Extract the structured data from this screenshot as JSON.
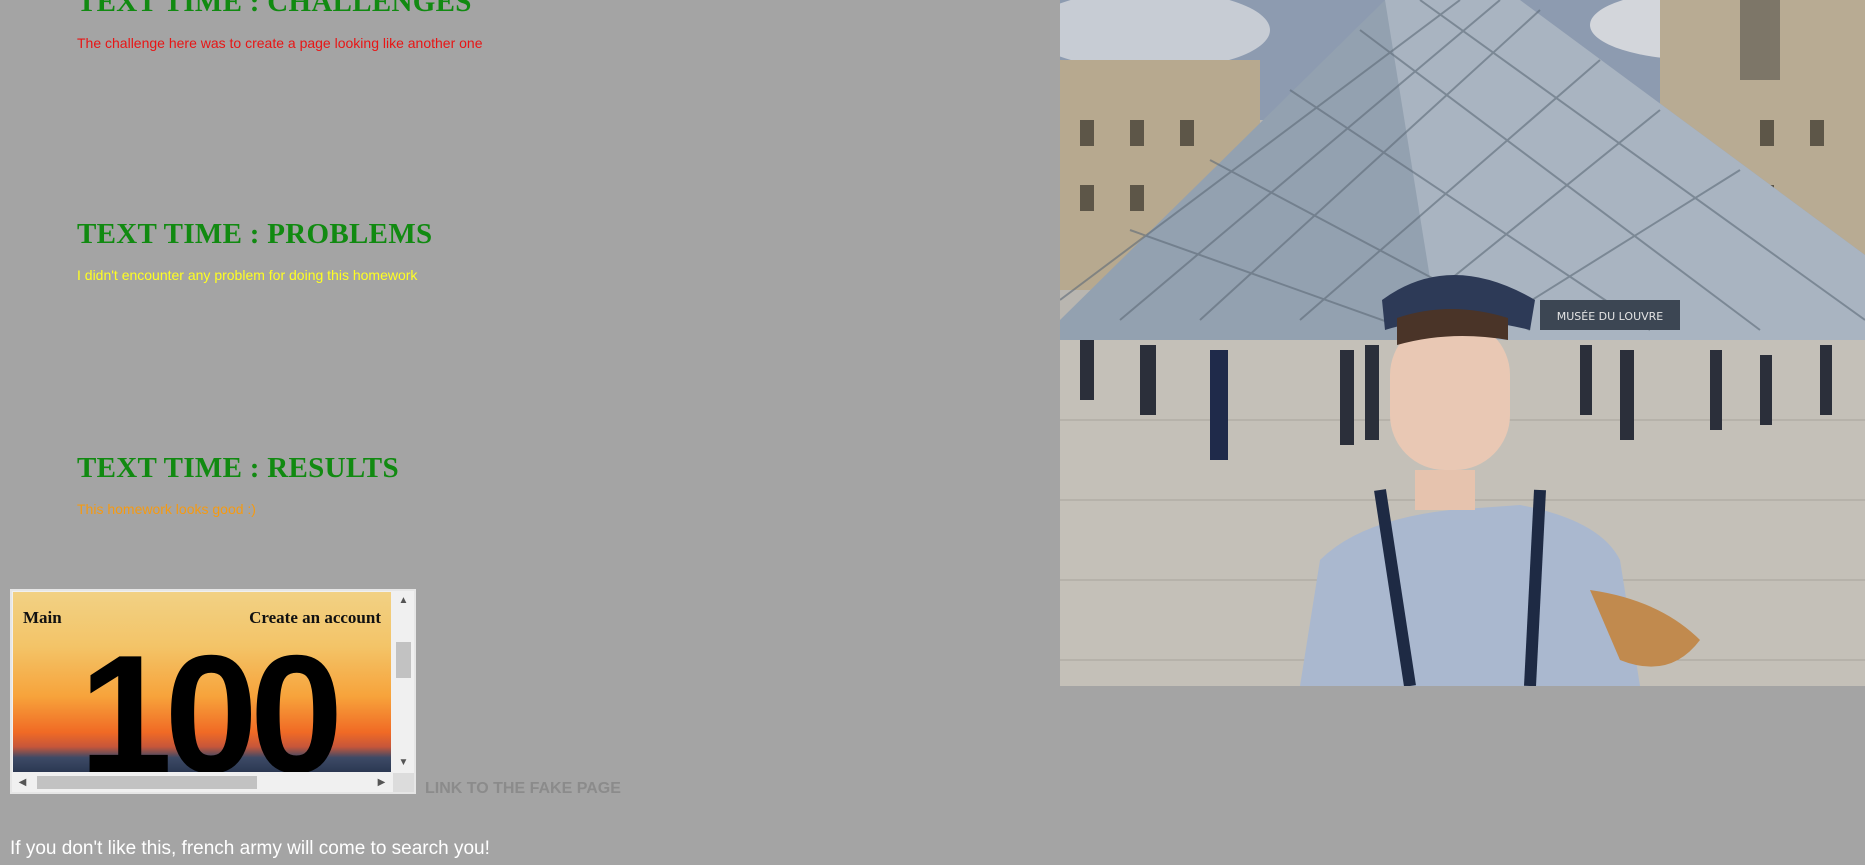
{
  "sections": {
    "challenges": {
      "title": "TEXT TIME : CHALLENGES",
      "text": "The challenge here was to create a page looking like another one"
    },
    "problems": {
      "title": "TEXT TIME : PROBLEMS",
      "text": "I didn't encounter any problem for doing this homework"
    },
    "results": {
      "title": "TEXT TIME : RESULTS",
      "text": "This homework looks good :)"
    }
  },
  "embedded_page": {
    "nav_left": "Main",
    "nav_right": "Create an account",
    "big_text": "100"
  },
  "photo": {
    "sign_text": "MUSÉE DU LOUVRE"
  },
  "link": {
    "label": "LINK TO THE FAKE PAGE"
  },
  "footer": {
    "text": "If you don't like this, french army will come to search you!"
  },
  "colors": {
    "background": "#a4a4a4",
    "heading": "#118a11",
    "challenges_text": "#e81515",
    "problems_text": "#ffff22",
    "results_text": "#f59a12",
    "link": "#8b8b8b",
    "footer": "#ffffff"
  }
}
